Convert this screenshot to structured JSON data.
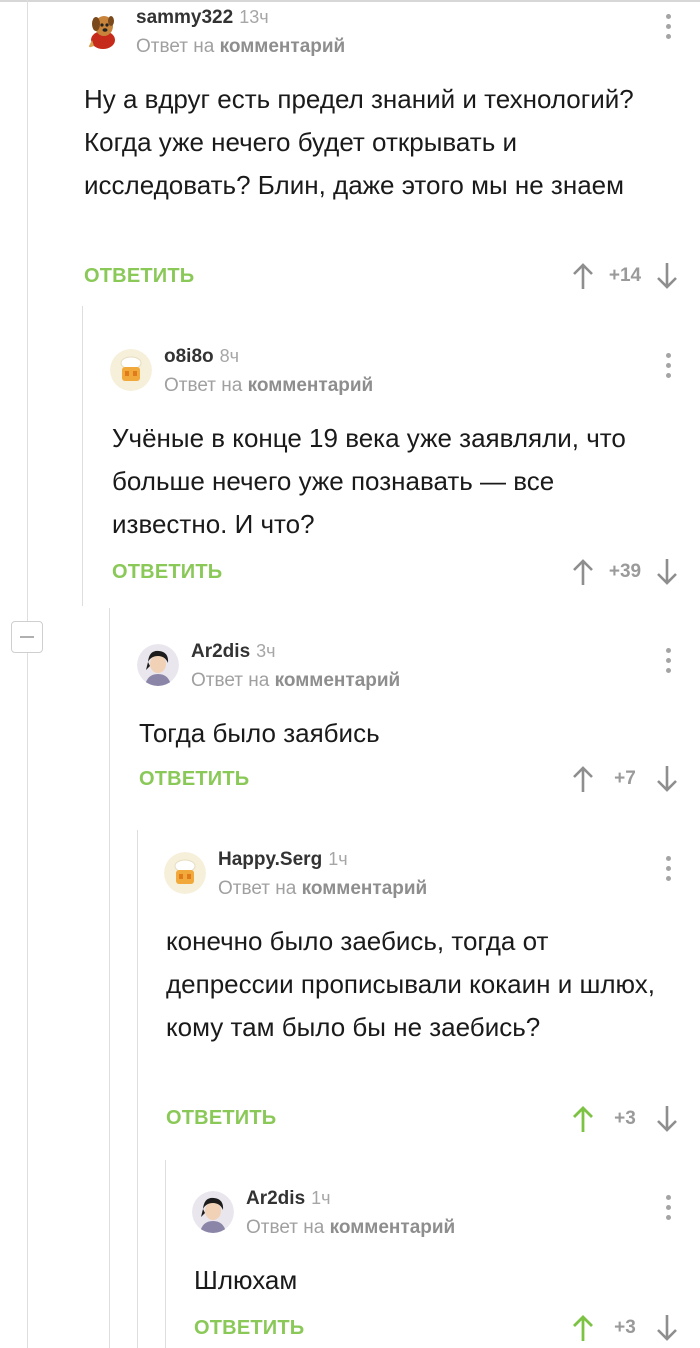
{
  "comments": [
    {
      "author": "sammy322",
      "time": "13ч",
      "reply_prefix": "Ответ на",
      "reply_target": "комментарий",
      "body": "Ну а вдруг есть предел знаний и технологий? Когда уже нечего будет открывать и исследовать? Блин, даже этого мы не знаем",
      "reply_label": "ОТВЕТИТЬ",
      "score": "+14",
      "upvoted": false,
      "avatar": "dog-avatar"
    },
    {
      "author": "o8i8o",
      "time": "8ч",
      "reply_prefix": "Ответ на",
      "reply_target": "комментарий",
      "body": "Учёные в конце 19 века уже заявляли, что больше нечего уже познавать — все известно. И что?",
      "reply_label": "ОТВЕТИТЬ",
      "score": "+39",
      "upvoted": false,
      "avatar": "default-chef-avatar"
    },
    {
      "author": "Ar2dis",
      "time": "3ч",
      "reply_prefix": "Ответ на",
      "reply_target": "комментарий",
      "body": "Тогда было заябись",
      "reply_label": "ОТВЕТИТЬ",
      "score": "+7",
      "upvoted": false,
      "avatar": "person-avatar"
    },
    {
      "author": "Happy.Serg",
      "time": "1ч",
      "reply_prefix": "Ответ на",
      "reply_target": "комментарий",
      "body": "конечно было заебись, тогда от депрессии прописывали кокаин и шлюх, кому там было бы не заебись?",
      "reply_label": "ОТВЕТИТЬ",
      "score": "+3",
      "upvoted": true,
      "avatar": "default-chef-avatar"
    },
    {
      "author": "Ar2dis",
      "time": "1ч",
      "reply_prefix": "Ответ на",
      "reply_target": "комментарий",
      "body": "Шлюхам",
      "reply_label": "ОТВЕТИТЬ",
      "score": "+3",
      "upvoted": true,
      "avatar": "person-avatar"
    }
  ],
  "colors": {
    "accent_green": "#8ac858",
    "upvoted_arrow": "#7cc344",
    "neutral_arrow": "#8e8e8e",
    "thread_line": "#dedede"
  }
}
